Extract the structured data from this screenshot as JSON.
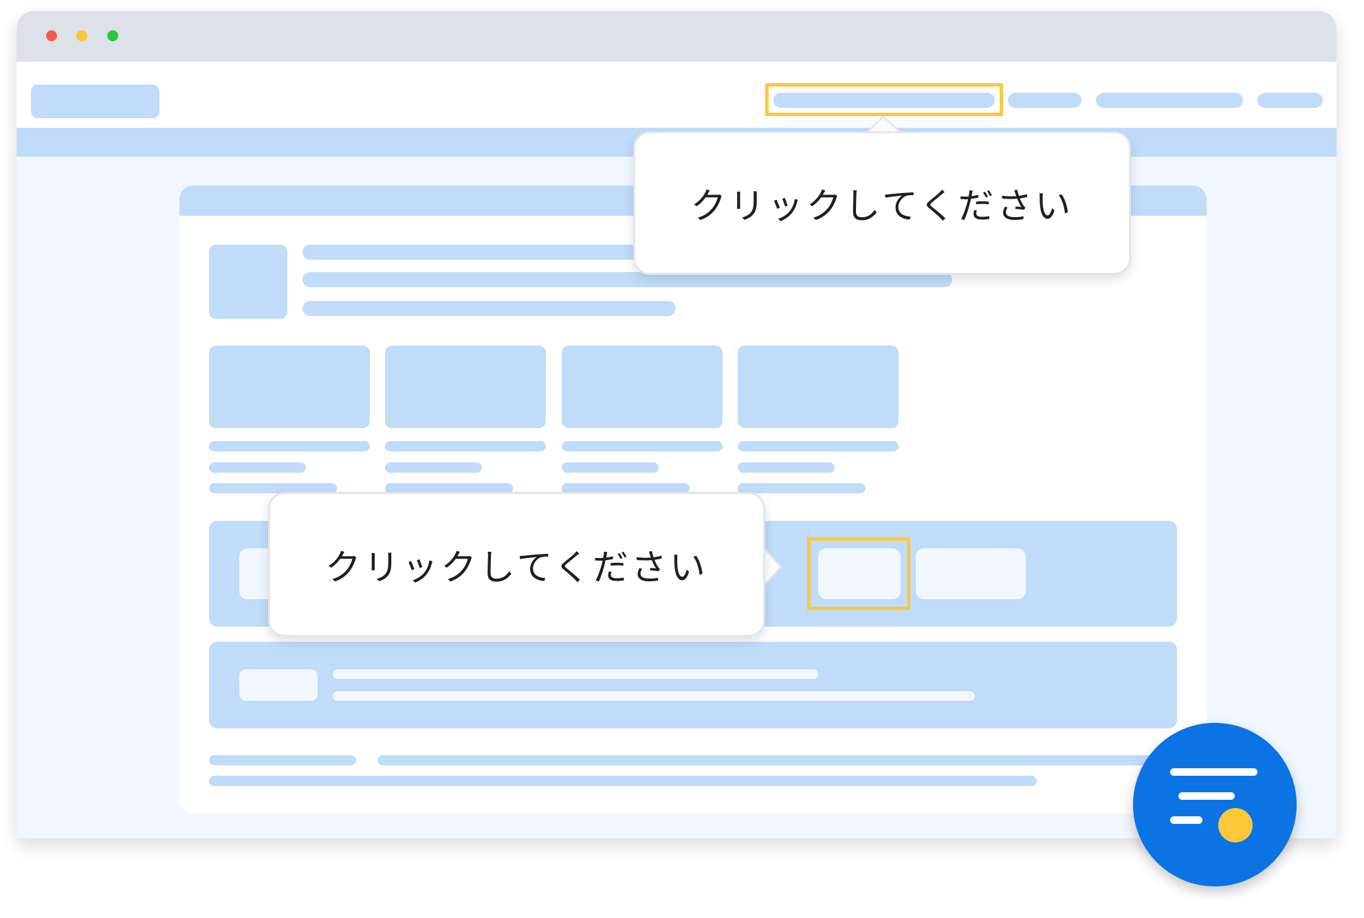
{
  "tooltips": {
    "top": {
      "text": "クリックしてください"
    },
    "middle": {
      "text": "クリックしてください"
    }
  },
  "colors": {
    "placeholder": "#c0dcfa",
    "page_background": "#f0f7ff",
    "highlight": "#fcc83a",
    "fab": "#0b73e3",
    "fab_dot": "#fcc83a",
    "close_dot": "#f25a55",
    "minimize_dot": "#fcc83a",
    "maximize_dot": "#26c940"
  },
  "icons": {
    "fab": "list-with-badge-icon"
  }
}
